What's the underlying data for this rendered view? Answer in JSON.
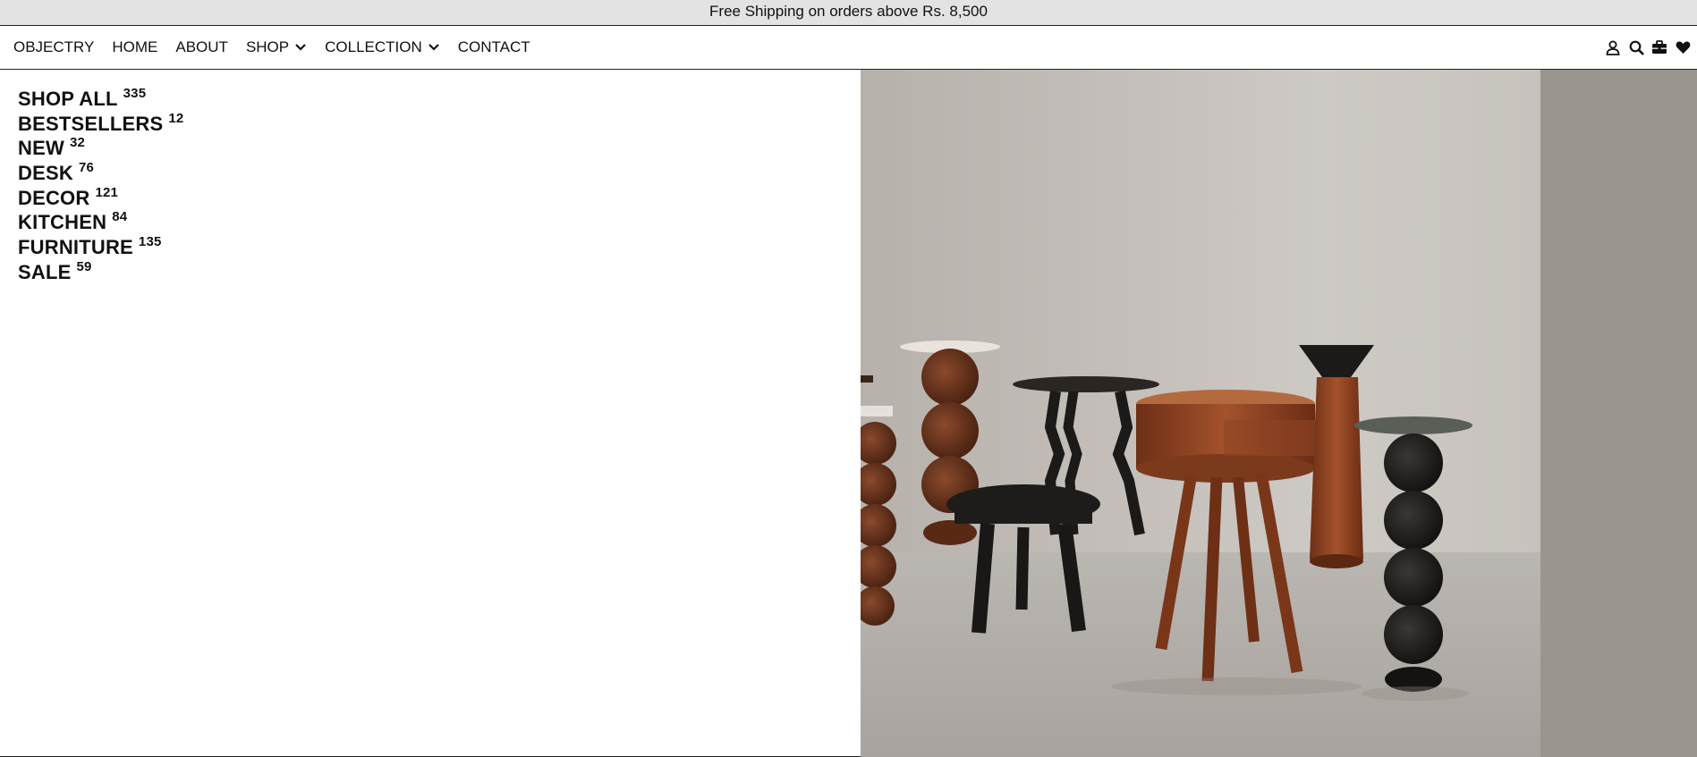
{
  "announcement": "Free Shipping on orders above Rs. 8,500",
  "nav": {
    "links": [
      {
        "label": "OBJECTRY"
      },
      {
        "label": "HOME"
      },
      {
        "label": "ABOUT"
      },
      {
        "label": "SHOP"
      },
      {
        "label": "COLLECTION"
      },
      {
        "label": "CONTACT"
      }
    ],
    "icons": [
      "user-icon",
      "search-icon",
      "briefcase-icon",
      "heart-icon"
    ]
  },
  "categories": [
    {
      "name": "SHOP ALL",
      "count": "335"
    },
    {
      "name": "BESTSELLERS",
      "count": "12"
    },
    {
      "name": "NEW",
      "count": "32"
    },
    {
      "name": "DESK",
      "count": "76"
    },
    {
      "name": "DECOR",
      "count": "121"
    },
    {
      "name": "KITCHEN",
      "count": "84"
    },
    {
      "name": "FURNITURE",
      "count": "135"
    },
    {
      "name": "SALE",
      "count": "59"
    }
  ]
}
